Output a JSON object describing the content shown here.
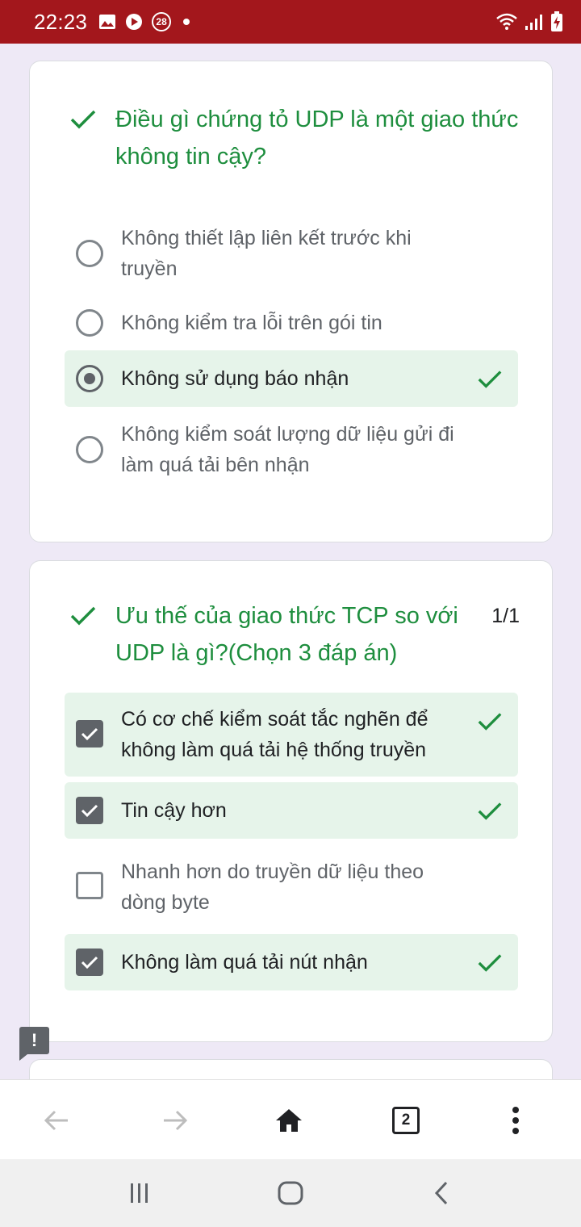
{
  "status_bar": {
    "time": "22:23",
    "notification_badge": "28",
    "icons": [
      "gallery-icon",
      "youtube-icon",
      "notification-count-icon",
      "dot-icon",
      "wifi-icon",
      "signal-icon",
      "battery-charging-icon"
    ]
  },
  "questions": [
    {
      "title": "Điều gì chứng tỏ UDP là một giao thức không tin cậy?",
      "score": "",
      "type": "radio",
      "options": [
        {
          "label": "Không thiết lập liên kết trước khi truyền",
          "selected": false,
          "correct": false
        },
        {
          "label": "Không kiểm tra lỗi trên gói tin",
          "selected": false,
          "correct": false
        },
        {
          "label": "Không sử dụng báo nhận",
          "selected": true,
          "correct": true
        },
        {
          "label": "Không kiểm soát lượng dữ liệu gửi đi làm quá tải bên nhận",
          "selected": false,
          "correct": false
        }
      ]
    },
    {
      "title": "Ưu thế của giao thức TCP so với UDP là gì?(Chọn 3 đáp án)",
      "score": "1/1",
      "type": "checkbox",
      "options": [
        {
          "label": "Có cơ chế kiểm soát tắc nghẽn để không làm quá tải hệ thống truyền",
          "selected": true,
          "correct": true
        },
        {
          "label": "Tin cậy hơn",
          "selected": true,
          "correct": true
        },
        {
          "label": "Nhanh hơn do truyền dữ liệu theo dòng byte",
          "selected": false,
          "correct": false
        },
        {
          "label": "Không làm quá tải nút nhận",
          "selected": true,
          "correct": true
        }
      ]
    }
  ],
  "feedback_button": {
    "label": "!"
  },
  "browser_toolbar": {
    "tab_count": "2",
    "icons": [
      "back-arrow-icon",
      "forward-arrow-icon",
      "home-icon",
      "tabs-icon",
      "more-vert-icon"
    ]
  },
  "colors": {
    "status_bar": "#a3171c",
    "page_background": "#eee9f6",
    "correct_green": "#1e8e3e",
    "correct_background": "#e6f4ea"
  }
}
